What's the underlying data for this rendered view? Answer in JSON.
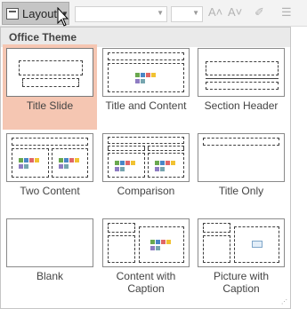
{
  "ribbon": {
    "layout_button_label": "Layout",
    "increase_font_glyph": "A˄",
    "decrease_font_glyph": "A˅",
    "clear_format_glyph": "✐",
    "bullets_glyph": "☰"
  },
  "gallery": {
    "section_title": "Office Theme",
    "layouts": [
      {
        "label": "Title Slide",
        "selected": true
      },
      {
        "label": "Title and Content",
        "selected": false
      },
      {
        "label": "Section Header",
        "selected": false
      },
      {
        "label": "Two Content",
        "selected": false
      },
      {
        "label": "Comparison",
        "selected": false
      },
      {
        "label": "Title Only",
        "selected": false
      },
      {
        "label": "Blank",
        "selected": false
      },
      {
        "label": "Content with Caption",
        "selected": false
      },
      {
        "label": "Picture with Caption",
        "selected": false
      }
    ],
    "content_icon_colors": [
      "#6aa84f",
      "#4a86c5",
      "#e06666",
      "#f1c232",
      "#8e7cc3",
      "#76a5af"
    ]
  }
}
